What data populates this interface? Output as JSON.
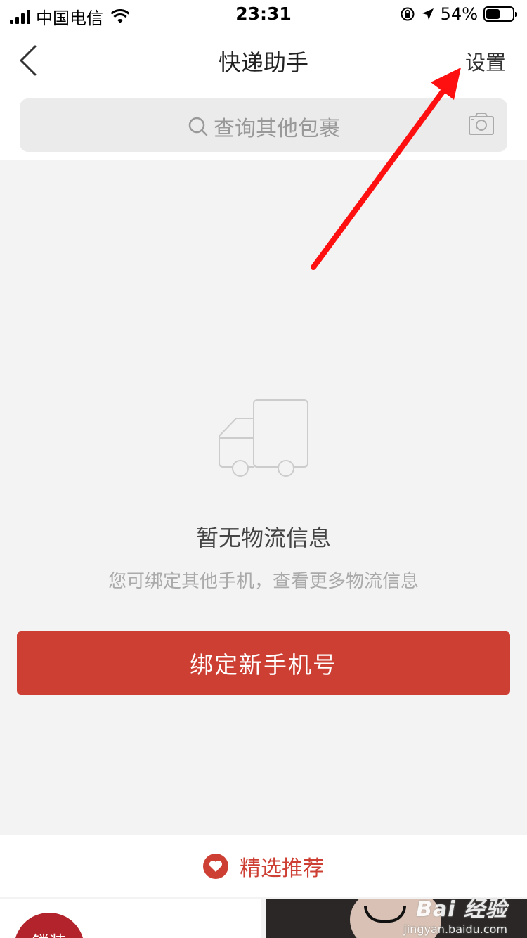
{
  "status_bar": {
    "carrier": "中国电信",
    "time": "23:31",
    "battery_percent": "54%",
    "battery_level": 0.54
  },
  "header": {
    "title": "快递助手",
    "settings_label": "设置"
  },
  "search": {
    "placeholder": "查询其他包裹"
  },
  "empty_state": {
    "title": "暂无物流信息",
    "subtitle": "您可绑定其他手机，查看更多物流信息",
    "button_label": "绑定新手机号"
  },
  "recommend": {
    "label": "精选推荐",
    "product_badge": "镂装"
  },
  "watermark": {
    "logo": "Bai 经验",
    "url": "jingyan.baidu.com"
  },
  "colors": {
    "accent": "#cd3e33",
    "annotation": "#ff1010"
  }
}
